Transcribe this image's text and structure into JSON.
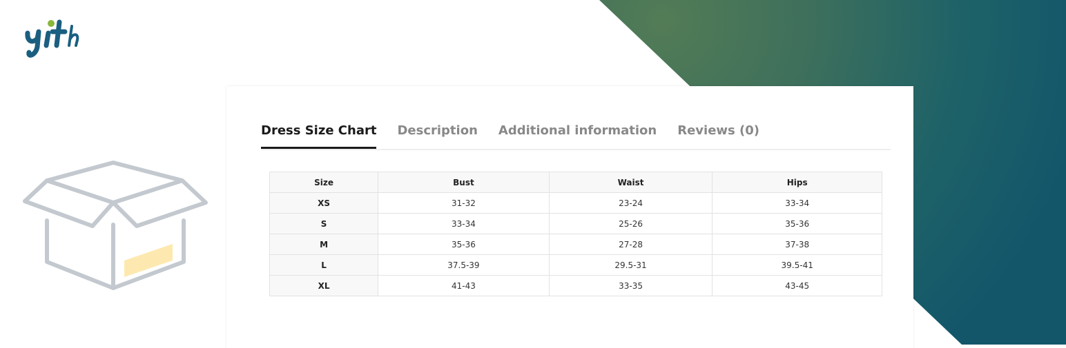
{
  "brand": {
    "logo_text": "yith",
    "colors": {
      "logo_blue": "#1a5f80",
      "logo_green": "#8ab83a",
      "gradient_green": "#4f7a55",
      "gradient_teal": "#145e6a",
      "box_gray": "#c3c9cf",
      "box_label_yellow": "#fde9b0"
    }
  },
  "illustration": {
    "icon": "open-box-icon"
  },
  "tabs": [
    {
      "label": "Dress Size Chart",
      "active": true
    },
    {
      "label": "Description",
      "active": false
    },
    {
      "label": "Additional information",
      "active": false
    },
    {
      "label": "Reviews (0)",
      "active": false
    }
  ],
  "table": {
    "headers": [
      "Size",
      "Bust",
      "Waist",
      "Hips"
    ],
    "rows": [
      [
        "XS",
        "31-32",
        "23-24",
        "33-34"
      ],
      [
        "S",
        "33-34",
        "25-26",
        "35-36"
      ],
      [
        "M",
        "35-36",
        "27-28",
        "37-38"
      ],
      [
        "L",
        "37.5-39",
        "29.5-31",
        "39.5-41"
      ],
      [
        "XL",
        "41-43",
        "33-35",
        "43-45"
      ]
    ]
  }
}
